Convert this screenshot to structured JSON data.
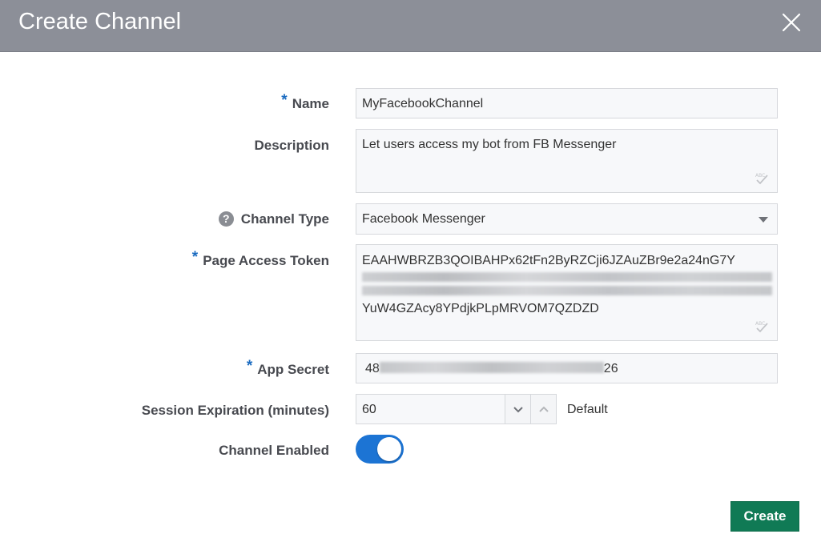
{
  "dialog": {
    "title": "Create Channel",
    "close_icon": "close-icon"
  },
  "form": {
    "name": {
      "label": "Name",
      "required_marker": "*",
      "value": "MyFacebookChannel"
    },
    "description": {
      "label": "Description",
      "value": "Let users access my bot from FB Messenger"
    },
    "channel_type": {
      "label": "Channel Type",
      "help_icon": "help-icon",
      "help_glyph": "?",
      "value": "Facebook Messenger"
    },
    "page_access_token": {
      "label": "Page Access Token",
      "required_marker": "*",
      "line1": "EAAHWBRZB3QOIBAHPx62tFn2ByRZCji6JZAuZBr9e2a24nG7Y",
      "line_last": "YuW4GZAcy8YPdjkPLpMRVOM7QZDZD"
    },
    "app_secret": {
      "label": "App Secret",
      "required_marker": "*",
      "value_prefix": "48",
      "value_suffix": "26"
    },
    "session_expiration": {
      "label": "Session Expiration (minutes)",
      "value": "60",
      "default_label": "Default"
    },
    "channel_enabled": {
      "label": "Channel Enabled",
      "enabled": true
    }
  },
  "footer": {
    "create_label": "Create"
  },
  "colors": {
    "titlebar": "#8c8f98",
    "accent_blue": "#1c74d4",
    "create_green": "#107a55"
  }
}
